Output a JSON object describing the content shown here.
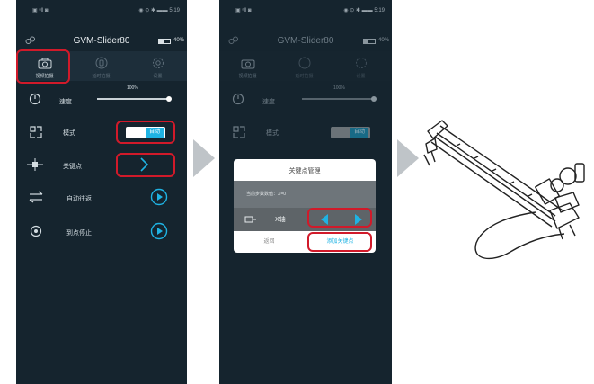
{
  "colors": {
    "accent": "#1fb3e3",
    "highlight": "#d11a2a",
    "screen_bg": "#15242e"
  },
  "screens": [
    {
      "status": {
        "left": "▣ ᵃll ◙",
        "right": "◉ ⊙ ✱ ▬▬ 5:19"
      },
      "title": "GVM-Slider80",
      "battery": "40%",
      "tabs": [
        {
          "label": "视频拍摄",
          "icon": "camera-icon"
        },
        {
          "label": "延时拍摄",
          "icon": "timelapse-icon"
        },
        {
          "label": "设置",
          "icon": "gear-icon"
        }
      ],
      "speed": {
        "label": "速度",
        "value_text": "100%",
        "value": 100
      },
      "mode": {
        "label": "模式",
        "toggle": "自动"
      },
      "keypoint": {
        "label": "关键点"
      },
      "auto_return": {
        "label": "自动往返"
      },
      "stop_at_point": {
        "label": "到点停止"
      }
    },
    {
      "status": {
        "left": "▣ ᵃll ◙",
        "right": "◉ ⊙ ✱ ▬▬ 5:19"
      },
      "title": "GVM-Slider80",
      "battery": "40%",
      "tabs": [
        {
          "label": "视频拍摄",
          "icon": "camera-icon"
        },
        {
          "label": "延时拍摄",
          "icon": "timelapse-icon"
        },
        {
          "label": "设置",
          "icon": "gear-icon"
        }
      ],
      "speed": {
        "label": "速度",
        "value_text": "100%"
      },
      "mode": {
        "label": "模式",
        "toggle": "自动"
      },
      "dialog": {
        "title": "关键点管理",
        "info": "当前步数数值：X=0",
        "axis_label": "X轴",
        "cancel": "返回",
        "add": "添加关键点"
      }
    }
  ]
}
